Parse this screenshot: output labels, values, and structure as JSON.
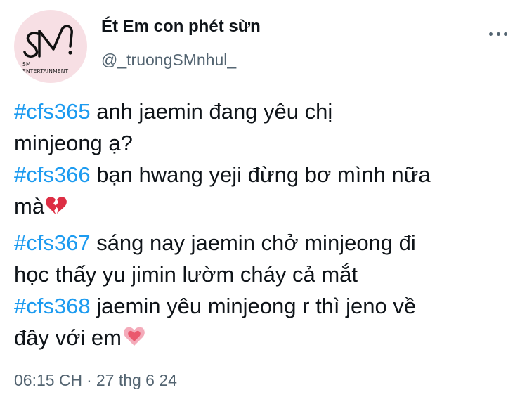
{
  "author": {
    "display_name": "Ét Em con phét sừn",
    "handle": "@_truongSMnhul_",
    "avatar_caption_line1": "SM",
    "avatar_caption_line2": "ENTERTAINMENT"
  },
  "tweet": {
    "lines": [
      {
        "hashtag": "#cfs365",
        "text": " anh jaemin đang yêu chị"
      },
      {
        "hashtag": "",
        "text": "minjeong ạ?"
      },
      {
        "hashtag": "#cfs366",
        "text": " bạn hwang yeji đừng bơ mình nữa"
      },
      {
        "hashtag": "",
        "text": "mà",
        "emoji": "broken-heart-icon"
      },
      {
        "hashtag": "#cfs367",
        "text": " sáng nay jaemin chở minjeong đi"
      },
      {
        "hashtag": "",
        "text": "học thấy yu jimin lườm cháy cả mắt"
      },
      {
        "hashtag": "#cfs368",
        "text": " jaemin yêu minjeong r thì jeno về"
      },
      {
        "hashtag": "",
        "text": "đây với em",
        "emoji": "sparkling-heart-icon"
      }
    ]
  },
  "meta": {
    "time": "06:15 CH",
    "separator": "·",
    "date": "27 thg 6 24"
  },
  "colors": {
    "hashtag": "#1d9bf0",
    "secondary_text": "#536471",
    "avatar_bg": "#f7dfe4"
  },
  "icons": {
    "more": "more-horizontal-icon"
  }
}
